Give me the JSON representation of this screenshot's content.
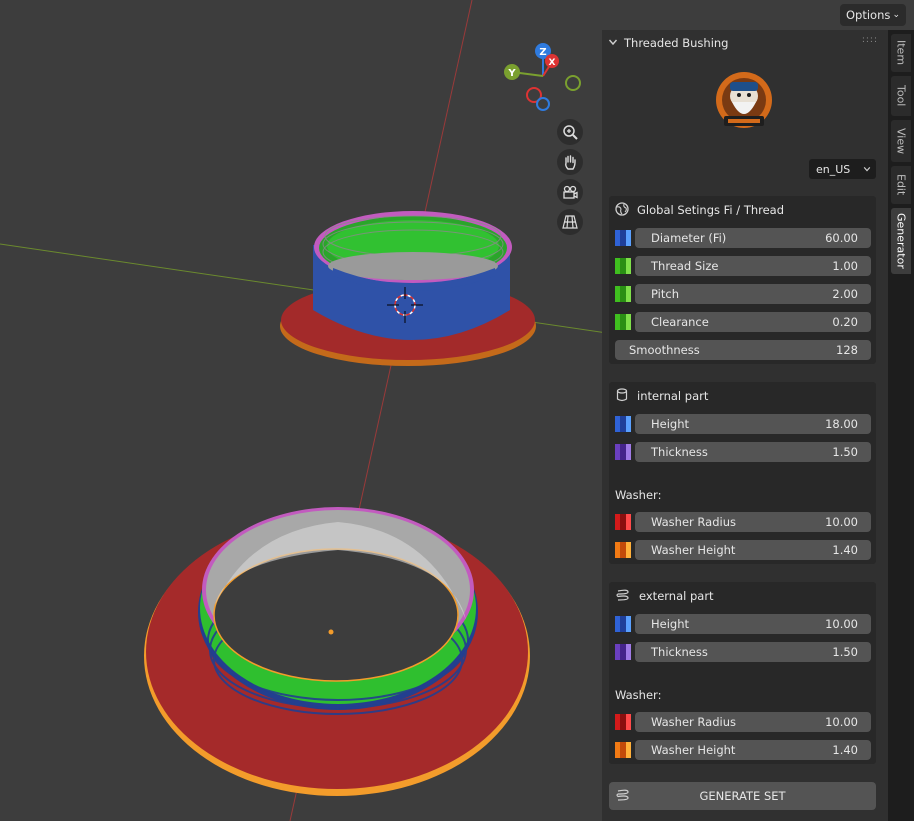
{
  "options_label": "Options",
  "gizmo": {
    "z": "Z",
    "x": "X",
    "y": "Y"
  },
  "panel": {
    "title": "Threaded Bushing",
    "language": "en_US",
    "global": {
      "title": "Global Setings Fi / Thread",
      "rows": [
        {
          "label": "Diameter (Fi)",
          "value": "60.00"
        },
        {
          "label": "Thread Size",
          "value": "1.00"
        },
        {
          "label": "Pitch",
          "value": "2.00"
        },
        {
          "label": "Clearance",
          "value": "0.20"
        }
      ],
      "smoothness": {
        "label": "Smoothness",
        "value": "128"
      }
    },
    "internal": {
      "title": "internal part",
      "rows": [
        {
          "label": "Height",
          "value": "18.00"
        },
        {
          "label": "Thickness",
          "value": "1.50"
        }
      ],
      "washer_label": "Washer:",
      "washer": [
        {
          "label": "Washer Radius",
          "value": "10.00"
        },
        {
          "label": "Washer Height",
          "value": "1.40"
        }
      ]
    },
    "external": {
      "title": "external part",
      "rows": [
        {
          "label": "Height",
          "value": "10.00"
        },
        {
          "label": "Thickness",
          "value": "1.50"
        }
      ],
      "washer_label": "Washer:",
      "washer": [
        {
          "label": "Washer Radius",
          "value": "10.00"
        },
        {
          "label": "Washer Height",
          "value": "1.40"
        }
      ]
    },
    "generate_label": "GENERATE SET"
  },
  "tabs": [
    "Item",
    "Tool",
    "View",
    "Edit",
    "Generator"
  ],
  "active_tab": "Generator",
  "colors": {
    "viewport_bg": "#3d3d3d",
    "panel_bg": "#303030",
    "field_bg": "#545454",
    "bushing_red": "#a52a2a",
    "bushing_blue": "#2f52a8",
    "thread_green": "#2fbf2f",
    "selection_orange": "#f39c2b"
  },
  "icons": {
    "zoom": "zoom-icon",
    "pan": "hand-icon",
    "camera": "camera-icon",
    "perspective": "grid-icon",
    "globe": "globe-icon",
    "cylinder": "cylinder-icon",
    "spring": "spring-icon"
  }
}
